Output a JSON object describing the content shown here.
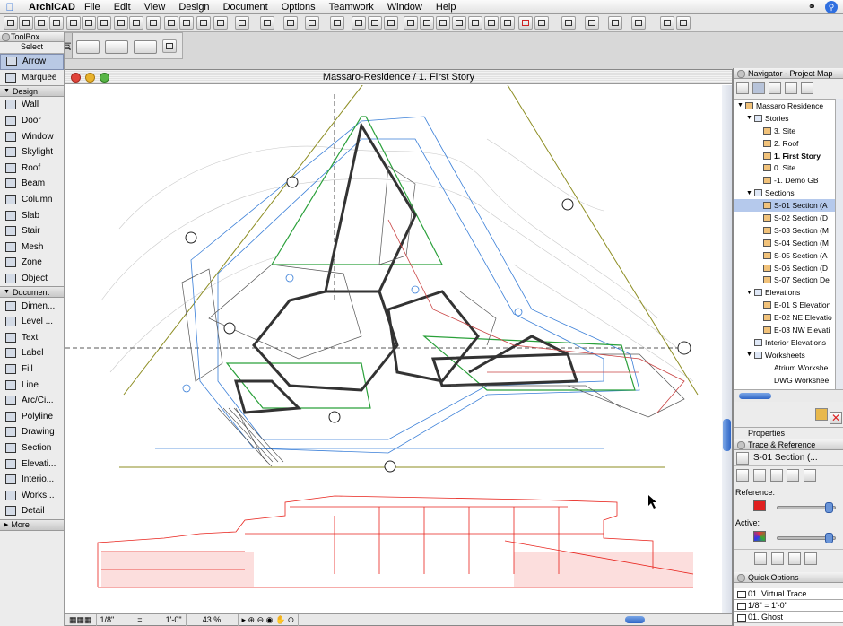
{
  "menubar": {
    "app": "ArchiCAD",
    "items": [
      "File",
      "Edit",
      "View",
      "Design",
      "Document",
      "Options",
      "Teamwork",
      "Window",
      "Help"
    ]
  },
  "toolbox": {
    "title": "ToolBox",
    "select_label": "Select",
    "select_tools": [
      "Arrow",
      "Marquee"
    ],
    "design_label": "Design",
    "design_tools": [
      "Wall",
      "Door",
      "Window",
      "Skylight",
      "Roof",
      "Beam",
      "Column",
      "Slab",
      "Stair",
      "Mesh",
      "Zone",
      "Object"
    ],
    "document_label": "Document",
    "document_tools": [
      "Dimen...",
      "Level ...",
      "Text",
      "Label",
      "Fill",
      "Line",
      "Arc/Ci...",
      "Polyline",
      "Drawing",
      "Section",
      "Elevati...",
      "Interio...",
      "Works...",
      "Detail"
    ],
    "more_label": "More"
  },
  "info_box": {
    "label": "Inf"
  },
  "window": {
    "title": "Massaro-Residence / 1. First Story",
    "status": {
      "scale_label": "1/8\"",
      "scale_eq": "=",
      "scale_value": "1'-0\"",
      "zoom": "43 %"
    }
  },
  "navigator": {
    "title": "Navigator - Project Map",
    "tree": [
      {
        "label": "Massaro Residence",
        "level": 0,
        "toggle": "down",
        "type": "house"
      },
      {
        "label": "Stories",
        "level": 1,
        "toggle": "down",
        "type": "fold"
      },
      {
        "label": "3. Site",
        "level": 2,
        "type": "story"
      },
      {
        "label": "2. Roof",
        "level": 2,
        "type": "story"
      },
      {
        "label": "1. First Story",
        "level": 2,
        "type": "story",
        "bold": true
      },
      {
        "label": "0. Site",
        "level": 2,
        "type": "story"
      },
      {
        "label": "-1. Demo GB",
        "level": 2,
        "type": "story"
      },
      {
        "label": "Sections",
        "level": 1,
        "toggle": "down",
        "type": "fold"
      },
      {
        "label": "S-01 Section (A",
        "level": 2,
        "type": "section",
        "selected": true
      },
      {
        "label": "S-02 Section (D",
        "level": 2,
        "type": "section"
      },
      {
        "label": "S-03 Section (M",
        "level": 2,
        "type": "section"
      },
      {
        "label": "S-04 Section (M",
        "level": 2,
        "type": "section"
      },
      {
        "label": "S-05 Section (A",
        "level": 2,
        "type": "section"
      },
      {
        "label": "S-06 Section (D",
        "level": 2,
        "type": "section"
      },
      {
        "label": "S-07 Section De",
        "level": 2,
        "type": "section"
      },
      {
        "label": "Elevations",
        "level": 1,
        "toggle": "down",
        "type": "fold"
      },
      {
        "label": "E-01 S Elevation",
        "level": 2,
        "type": "section"
      },
      {
        "label": "E-02 NE Elevatio",
        "level": 2,
        "type": "section"
      },
      {
        "label": "E-03 NW Elevati",
        "level": 2,
        "type": "section"
      },
      {
        "label": "Interior Elevations",
        "level": 1,
        "type": "fold"
      },
      {
        "label": "Worksheets",
        "level": 1,
        "toggle": "down",
        "type": "fold"
      },
      {
        "label": "Atrium Workshe",
        "level": 2,
        "type": "sheet"
      },
      {
        "label": "DWG Workshee",
        "level": 2,
        "type": "sheet"
      }
    ],
    "properties_label": "Properties"
  },
  "trace": {
    "title": "Trace & Reference",
    "current": "S-01 Section (...",
    "reference_label": "Reference:",
    "active_label": "Active:",
    "reference_color": "#e02020",
    "reference_level": 0.95,
    "active_level": 0.95
  },
  "quick_options": {
    "title": "Quick Options",
    "rows": [
      "01. Virtual Trace",
      "1/8\"  =  1'-0\"",
      "01. Ghost"
    ]
  },
  "colors": {
    "plan": "#333333",
    "elevation": "#e8231c",
    "grid": "#3a7fd8",
    "accent": "#2f6fe0"
  }
}
